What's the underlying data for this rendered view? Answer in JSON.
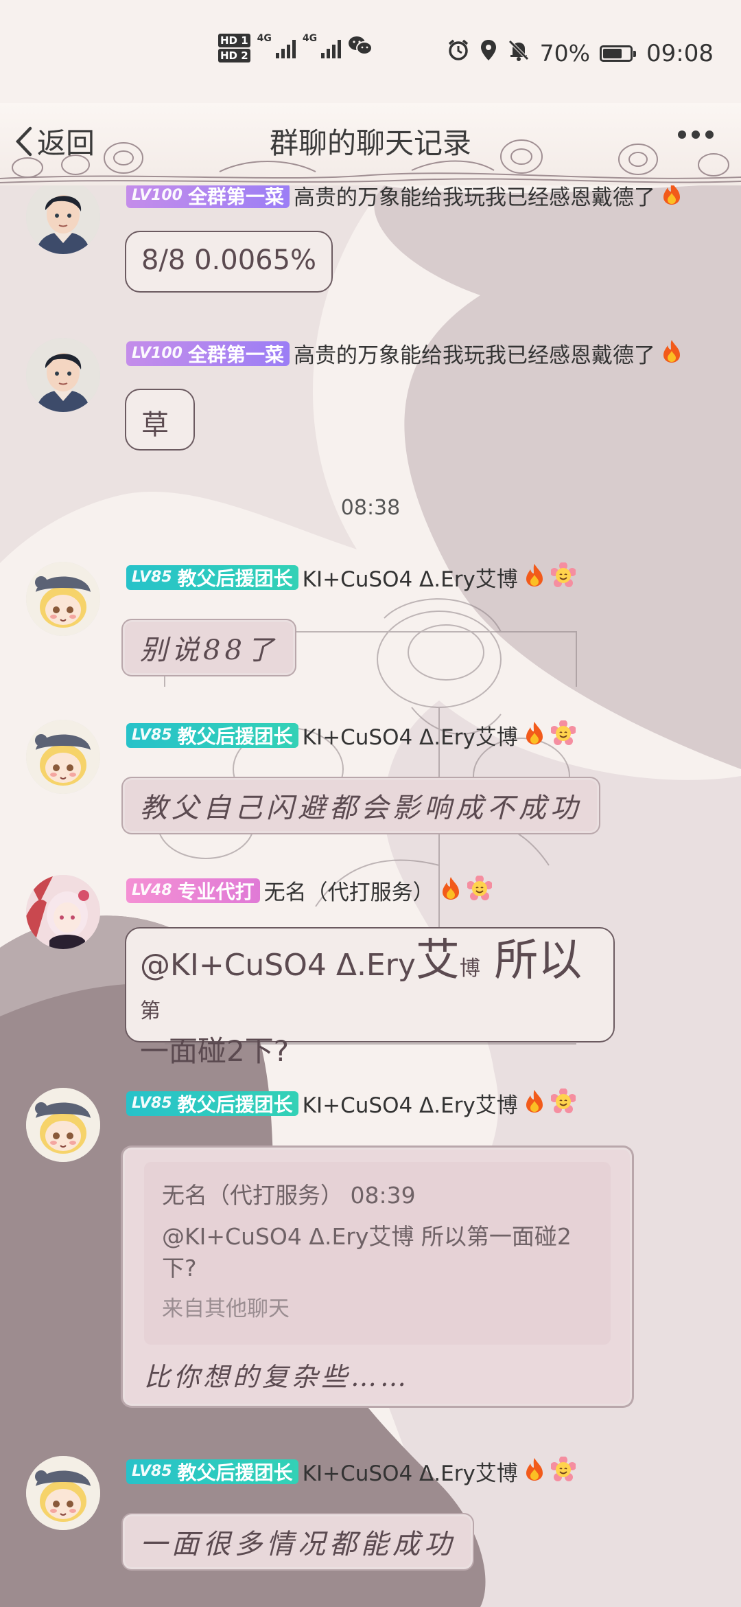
{
  "status_bar": {
    "hd1": "HD 1",
    "hd2": "HD 2",
    "net1": "4G",
    "net2": "4G",
    "battery_text": "70%",
    "battery_level": 0.7,
    "time": "09:08",
    "icons": [
      "wechat-icon",
      "alarm-icon",
      "location-icon",
      "mute-bell-icon"
    ]
  },
  "nav": {
    "back_label": "返回",
    "title": "群聊的聊天记录",
    "more_icon": "more-dots-icon"
  },
  "messages": [
    {
      "level": "LV100",
      "title": "全群第一菜",
      "name": "高贵的万象能给我玩我已经感恩戴德了",
      "icons": [
        "fire-icon"
      ],
      "text": "8/8  0.0065%",
      "badge_color": "#a686f2"
    },
    {
      "level": "LV100",
      "title": "全群第一菜",
      "name": "高贵的万象能给我玩我已经感恩戴德了",
      "icons": [
        "fire-icon"
      ],
      "text": "草"
    },
    {
      "time_separator": "08:38"
    },
    {
      "level": "LV85",
      "title": "教父后援团长",
      "name": "KI+CuSO4 Δ.Ery艾博",
      "icons": [
        "fire-icon",
        "smile-flower-icon"
      ],
      "text": "别说88了",
      "badge_color": "#2cc6c2"
    },
    {
      "level": "LV85",
      "title": "教父后援团长",
      "name": "KI+CuSO4 Δ.Ery艾博",
      "icons": [
        "fire-icon",
        "smile-flower-icon"
      ],
      "text": "教父自己闪避都会影响成不成功"
    },
    {
      "level": "LV48",
      "title": "专业代打",
      "name": "无名（代打服务）",
      "icons": [
        "fire-icon",
        "smile-flower-icon"
      ],
      "text_parts": [
        "@KI+CuSO4 Δ.Ery",
        "艾",
        "博",
        " 所以",
        "第",
        "一面碰2下?"
      ],
      "badge_color": "#f08ad6"
    },
    {
      "level": "LV85",
      "title": "教父后援团长",
      "name": "KI+CuSO4 Δ.Ery艾博",
      "icons": [
        "fire-icon",
        "smile-flower-icon"
      ],
      "quote": {
        "header": "无名（代打服务）  08:39",
        "body": "@KI+CuSO4 Δ.Ery艾博 所以第一面碰2下?",
        "source": "来自其他聊天"
      },
      "text": "比你想的复杂些……"
    },
    {
      "level": "LV85",
      "title": "教父后援团长",
      "name": "KI+CuSO4 Δ.Ery艾博",
      "icons": [
        "fire-icon",
        "smile-flower-icon"
      ],
      "text": "一面很多情况都能成功"
    }
  ],
  "colors": {
    "accent_text": "#5b4a50",
    "bubble_border": "#6b5a60",
    "bg_dark": "#9b8b8e",
    "bg_light": "#f5efec"
  }
}
